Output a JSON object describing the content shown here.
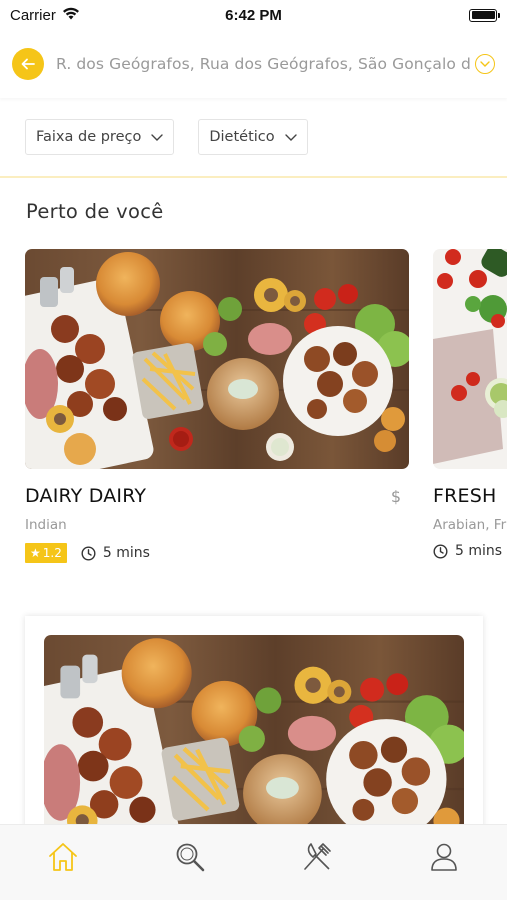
{
  "status_bar": {
    "carrier": "Carrier",
    "time": "6:42 PM"
  },
  "address": {
    "text": "R. dos Geógrafos, Rua dos Geógrafos, São Gonçalo do Amarante"
  },
  "filters": [
    {
      "label": "Faixa de preço"
    },
    {
      "label": "Dietético"
    }
  ],
  "section": {
    "title": "Perto de você"
  },
  "restaurants": [
    {
      "name": "DAIRY DAIRY",
      "price": "$",
      "cuisine": "Indian",
      "rating": "1.2",
      "time": "5 mins"
    },
    {
      "name": "FRESH",
      "price": "",
      "cuisine": "Arabian, Fr",
      "rating": "",
      "time": "5 mins"
    }
  ],
  "colors": {
    "accent": "#f5c518",
    "muted_text": "#999999"
  },
  "tabs": [
    {
      "icon": "home-icon",
      "active": true
    },
    {
      "icon": "search-icon",
      "active": false
    },
    {
      "icon": "fork-knife-icon",
      "active": false
    },
    {
      "icon": "user-icon",
      "active": false
    }
  ]
}
